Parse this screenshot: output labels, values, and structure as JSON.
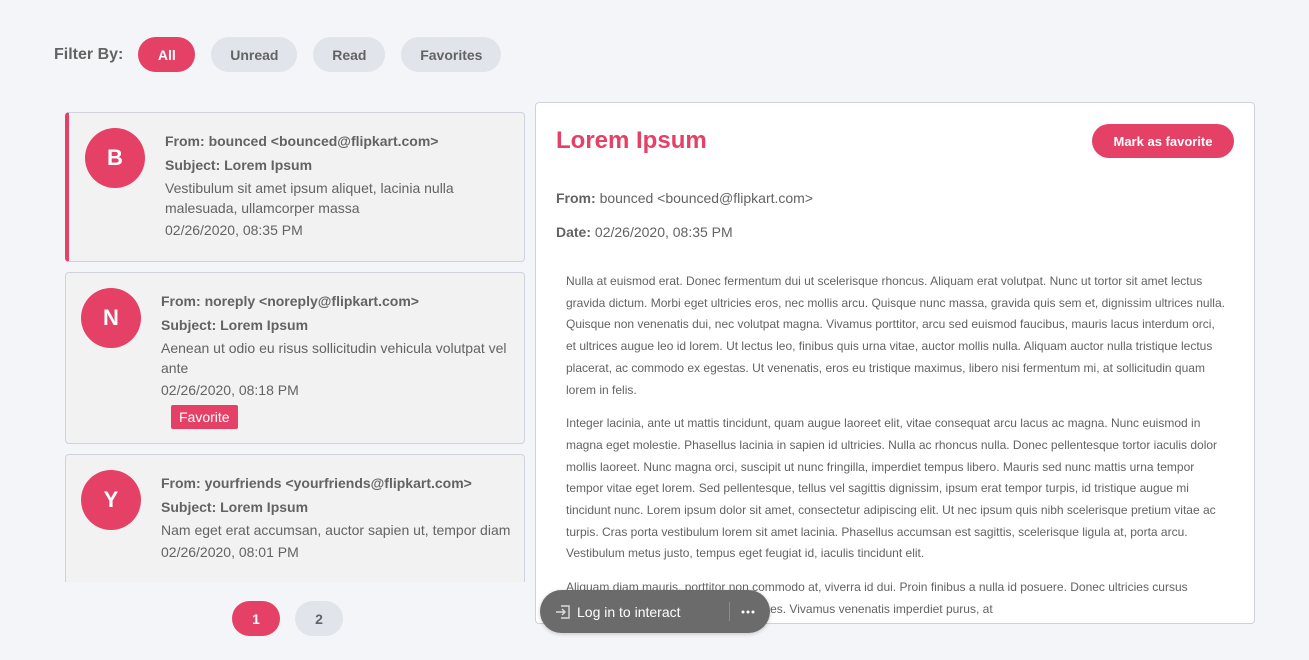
{
  "filter": {
    "label": "Filter By:",
    "options": [
      "All",
      "Unread",
      "Read",
      "Favorites"
    ],
    "active": "All"
  },
  "emails": [
    {
      "initial": "B",
      "from_label": "From:",
      "from": "bounced <bounced@flipkart.com>",
      "subject_label": "Subject:",
      "subject": "Lorem Ipsum",
      "preview": "Vestibulum sit amet ipsum aliquet, lacinia nulla malesuada, ullamcorper massa",
      "date": "02/26/2020, 08:35 PM",
      "favorite": false,
      "selected": true
    },
    {
      "initial": "N",
      "from_label": "From:",
      "from": "noreply <noreply@flipkart.com>",
      "subject_label": "Subject:",
      "subject": "Lorem Ipsum",
      "preview": "Aenean ut odio eu risus sollicitudin vehicula volutpat vel ante",
      "date": "02/26/2020, 08:18 PM",
      "favorite": true,
      "favorite_label": "Favorite",
      "selected": false
    },
    {
      "initial": "Y",
      "from_label": "From:",
      "from": "yourfriends <yourfriends@flipkart.com>",
      "subject_label": "Subject:",
      "subject": "Lorem Ipsum",
      "preview": "Nam eget erat accumsan, auctor sapien ut, tempor diam",
      "date": "02/26/2020, 08:01 PM",
      "favorite": false,
      "selected": false
    }
  ],
  "pagination": {
    "pages": [
      "1",
      "2"
    ],
    "current": "1"
  },
  "detail": {
    "title": "Lorem Ipsum",
    "favorite_button": "Mark as favorite",
    "from_label": "From:",
    "from": "bounced <bounced@flipkart.com>",
    "date_label": "Date:",
    "date": "02/26/2020, 08:35 PM",
    "paragraphs": [
      "Nulla at euismod erat. Donec fermentum dui ut scelerisque rhoncus. Aliquam erat volutpat. Nunc ut tortor sit amet lectus gravida dictum. Morbi eget ultricies eros, nec mollis arcu. Quisque nunc massa, gravida quis sem et, dignissim ultrices nulla. Quisque non venenatis dui, nec volutpat magna. Vivamus porttitor, arcu sed euismod faucibus, mauris lacus interdum orci, et ultrices augue leo id lorem. Ut lectus leo, finibus quis urna vitae, auctor mollis nulla. Aliquam auctor nulla tristique lectus placerat, ac commodo ex egestas. Ut venenatis, eros eu tristique maximus, libero nisi fermentum mi, at sollicitudin quam lorem in felis.",
      "Integer lacinia, ante ut mattis tincidunt, quam augue laoreet elit, vitae consequat arcu lacus ac magna. Nunc euismod in magna eget molestie. Phasellus lacinia in sapien id ultricies. Nulla ac rhoncus nulla. Donec pellentesque tortor iaculis dolor mollis laoreet. Nunc magna orci, suscipit ut nunc fringilla, imperdiet tempus libero. Mauris sed nunc mattis urna tempor tempor vitae eget lorem. Sed pellentesque, tellus vel sagittis dignissim, ipsum erat tempor turpis, id tristique augue mi tincidunt nunc. Lorem ipsum dolor sit amet, consectetur adipiscing elit. Ut nec ipsum quis nibh scelerisque pretium vitae ac turpis. Cras porta vestibulum lorem sit amet lacinia. Phasellus accumsan est sagittis, scelerisque ligula at, porta arcu. Vestibulum metus justo, tempus eget feugiat id, iaculis tincidunt elit.",
      "Aliquam diam mauris, porttitor non commodo at, viverra id dui. Proin finibus a nulla id posuere. Donec ultricies cursus Aliquam a massa eu erat gravida ultrices. Vivamus venenatis imperdiet purus, at"
    ]
  },
  "overlay": {
    "login_text": "Log in to interact",
    "login_icon": "login-icon",
    "more_icon": "more-icon"
  },
  "colors": {
    "accent": "#e54065",
    "background": "#f4f5f9",
    "text": "#636363",
    "chip": "#e1e4ea"
  }
}
